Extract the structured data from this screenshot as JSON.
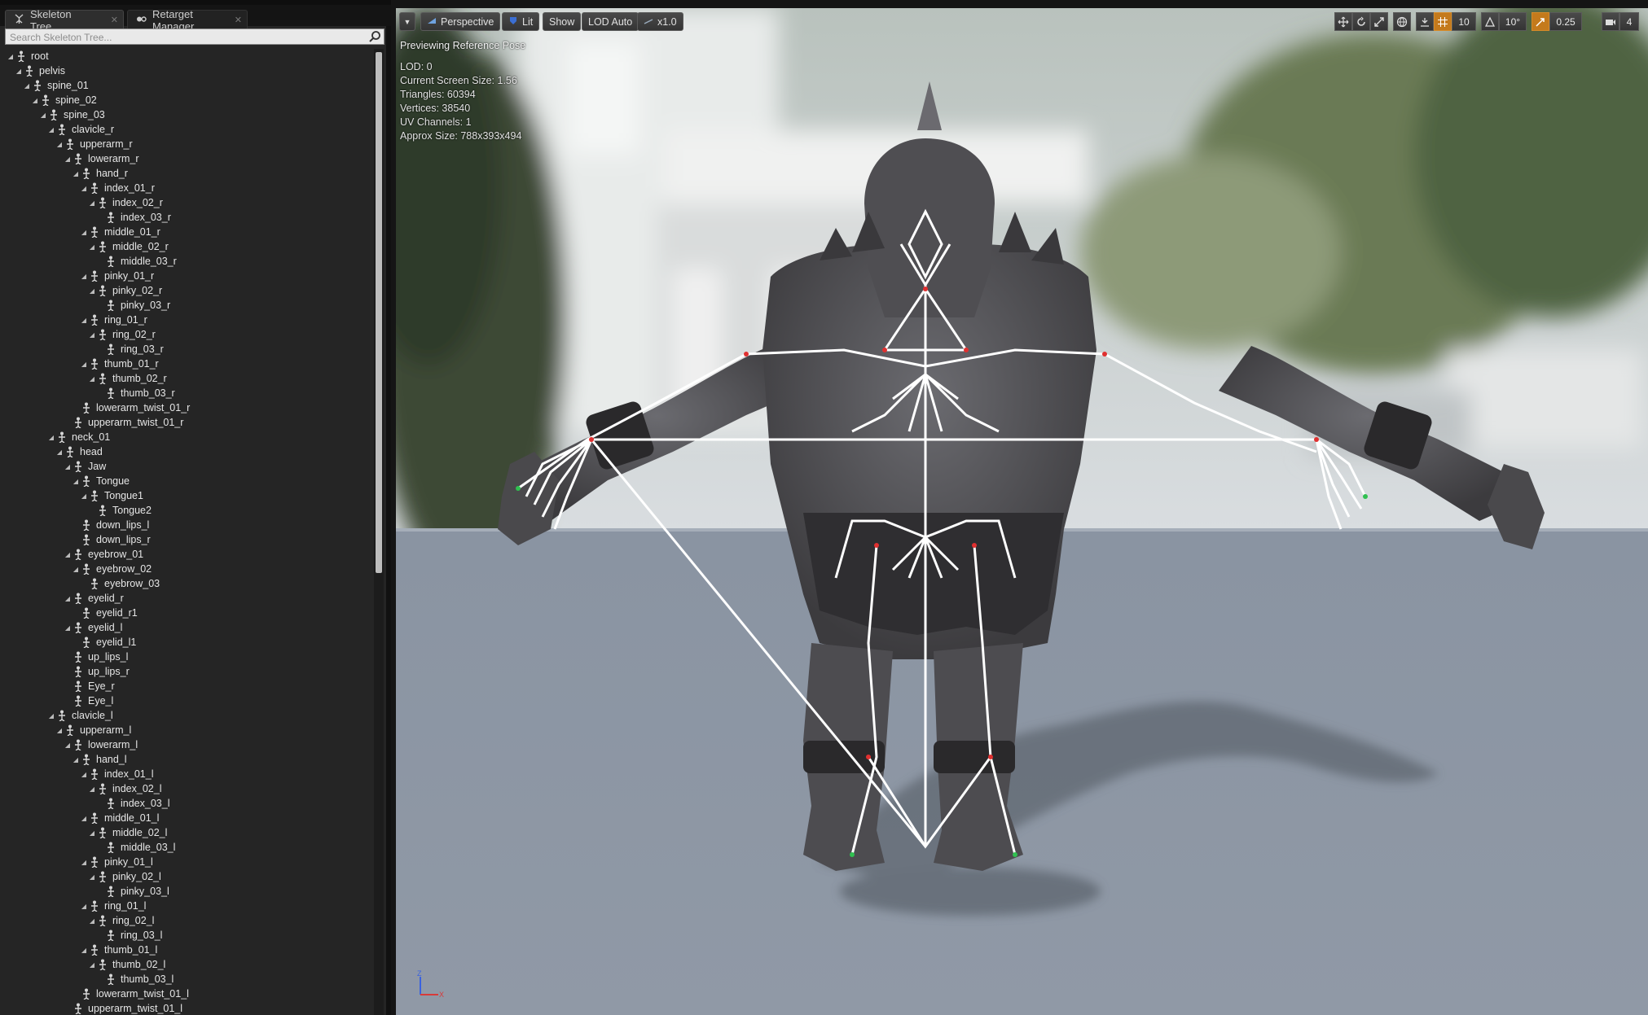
{
  "tabs": [
    {
      "label": "Skeleton Tree",
      "active": true
    },
    {
      "label": "Retarget Manager",
      "active": false
    }
  ],
  "search": {
    "placeholder": "Search Skeleton Tree..."
  },
  "tree": [
    {
      "name": "root",
      "depth": 0,
      "arrow": true
    },
    {
      "name": "pelvis",
      "depth": 1,
      "arrow": true
    },
    {
      "name": "spine_01",
      "depth": 2,
      "arrow": true
    },
    {
      "name": "spine_02",
      "depth": 3,
      "arrow": true
    },
    {
      "name": "spine_03",
      "depth": 4,
      "arrow": true
    },
    {
      "name": "clavicle_r",
      "depth": 5,
      "arrow": true
    },
    {
      "name": "upperarm_r",
      "depth": 6,
      "arrow": true
    },
    {
      "name": "lowerarm_r",
      "depth": 7,
      "arrow": true
    },
    {
      "name": "hand_r",
      "depth": 8,
      "arrow": true
    },
    {
      "name": "index_01_r",
      "depth": 9,
      "arrow": true
    },
    {
      "name": "index_02_r",
      "depth": 10,
      "arrow": true
    },
    {
      "name": "index_03_r",
      "depth": 11,
      "arrow": false
    },
    {
      "name": "middle_01_r",
      "depth": 9,
      "arrow": true
    },
    {
      "name": "middle_02_r",
      "depth": 10,
      "arrow": true
    },
    {
      "name": "middle_03_r",
      "depth": 11,
      "arrow": false
    },
    {
      "name": "pinky_01_r",
      "depth": 9,
      "arrow": true
    },
    {
      "name": "pinky_02_r",
      "depth": 10,
      "arrow": true
    },
    {
      "name": "pinky_03_r",
      "depth": 11,
      "arrow": false
    },
    {
      "name": "ring_01_r",
      "depth": 9,
      "arrow": true
    },
    {
      "name": "ring_02_r",
      "depth": 10,
      "arrow": true
    },
    {
      "name": "ring_03_r",
      "depth": 11,
      "arrow": false
    },
    {
      "name": "thumb_01_r",
      "depth": 9,
      "arrow": true
    },
    {
      "name": "thumb_02_r",
      "depth": 10,
      "arrow": true
    },
    {
      "name": "thumb_03_r",
      "depth": 11,
      "arrow": false
    },
    {
      "name": "lowerarm_twist_01_r",
      "depth": 8,
      "arrow": false
    },
    {
      "name": "upperarm_twist_01_r",
      "depth": 7,
      "arrow": false
    },
    {
      "name": "neck_01",
      "depth": 5,
      "arrow": true
    },
    {
      "name": "head",
      "depth": 6,
      "arrow": true
    },
    {
      "name": "Jaw",
      "depth": 7,
      "arrow": true
    },
    {
      "name": "Tongue",
      "depth": 8,
      "arrow": true
    },
    {
      "name": "Tongue1",
      "depth": 9,
      "arrow": true
    },
    {
      "name": "Tongue2",
      "depth": 10,
      "arrow": false
    },
    {
      "name": "down_lips_l",
      "depth": 8,
      "arrow": false
    },
    {
      "name": "down_lips_r",
      "depth": 8,
      "arrow": false
    },
    {
      "name": "eyebrow_01",
      "depth": 7,
      "arrow": true
    },
    {
      "name": "eyebrow_02",
      "depth": 8,
      "arrow": true
    },
    {
      "name": "eyebrow_03",
      "depth": 9,
      "arrow": false
    },
    {
      "name": "eyelid_r",
      "depth": 7,
      "arrow": true
    },
    {
      "name": "eyelid_r1",
      "depth": 8,
      "arrow": false
    },
    {
      "name": "eyelid_l",
      "depth": 7,
      "arrow": true
    },
    {
      "name": "eyelid_l1",
      "depth": 8,
      "arrow": false
    },
    {
      "name": "up_lips_l",
      "depth": 7,
      "arrow": false
    },
    {
      "name": "up_lips_r",
      "depth": 7,
      "arrow": false
    },
    {
      "name": "Eye_r",
      "depth": 7,
      "arrow": false
    },
    {
      "name": "Eye_l",
      "depth": 7,
      "arrow": false
    },
    {
      "name": "clavicle_l",
      "depth": 5,
      "arrow": true
    },
    {
      "name": "upperarm_l",
      "depth": 6,
      "arrow": true
    },
    {
      "name": "lowerarm_l",
      "depth": 7,
      "arrow": true
    },
    {
      "name": "hand_l",
      "depth": 8,
      "arrow": true
    },
    {
      "name": "index_01_l",
      "depth": 9,
      "arrow": true
    },
    {
      "name": "index_02_l",
      "depth": 10,
      "arrow": true
    },
    {
      "name": "index_03_l",
      "depth": 11,
      "arrow": false
    },
    {
      "name": "middle_01_l",
      "depth": 9,
      "arrow": true
    },
    {
      "name": "middle_02_l",
      "depth": 10,
      "arrow": true
    },
    {
      "name": "middle_03_l",
      "depth": 11,
      "arrow": false
    },
    {
      "name": "pinky_01_l",
      "depth": 9,
      "arrow": true
    },
    {
      "name": "pinky_02_l",
      "depth": 10,
      "arrow": true
    },
    {
      "name": "pinky_03_l",
      "depth": 11,
      "arrow": false
    },
    {
      "name": "ring_01_l",
      "depth": 9,
      "arrow": true
    },
    {
      "name": "ring_02_l",
      "depth": 10,
      "arrow": true
    },
    {
      "name": "ring_03_l",
      "depth": 11,
      "arrow": false
    },
    {
      "name": "thumb_01_l",
      "depth": 9,
      "arrow": true
    },
    {
      "name": "thumb_02_l",
      "depth": 10,
      "arrow": true
    },
    {
      "name": "thumb_03_l",
      "depth": 11,
      "arrow": false
    },
    {
      "name": "lowerarm_twist_01_l",
      "depth": 8,
      "arrow": false
    },
    {
      "name": "upperarm_twist_01_l",
      "depth": 7,
      "arrow": false
    }
  ],
  "viewport": {
    "toolbar": {
      "perspective": "Perspective",
      "lit": "Lit",
      "show": "Show",
      "lod": "LOD Auto",
      "speed": "x1.0"
    },
    "overlay": {
      "title": "Previewing Reference Pose",
      "lod": "LOD: 0",
      "screen_size": "Current Screen Size: 1.56",
      "triangles": "Triangles: 60394",
      "vertices": "Vertices: 38540",
      "uv_channels": "UV Channels: 1",
      "approx_size": "Approx Size: 788x393x494"
    },
    "right_tools": {
      "grid_snap": "10",
      "rotate_snap": "10°",
      "scale_snap": "0.25",
      "camera_speed": "4"
    },
    "axis": {
      "z": "Z",
      "x": "X"
    }
  },
  "colors": {
    "accent_orange": "#c47a1c",
    "lit_blue": "#3b6fd4",
    "panel_bg": "#252525",
    "floor": "#8c97a6"
  }
}
